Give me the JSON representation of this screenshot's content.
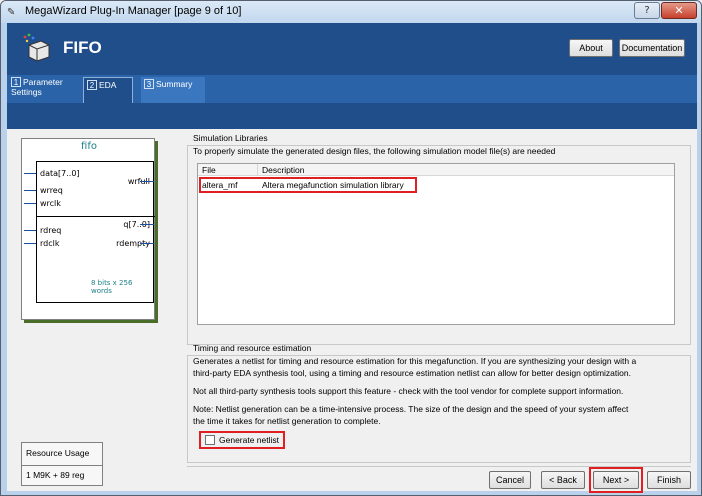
{
  "window": {
    "title": "MegaWizard Plug-In Manager [page 9 of 10]",
    "help_glyph": "?",
    "close_glyph": "✕"
  },
  "header": {
    "title": "FIFO",
    "about_label": "About",
    "documentation_label": "Documentation"
  },
  "tabs": [
    {
      "num": "1",
      "label": "Parameter Settings"
    },
    {
      "num": "2",
      "label": "EDA"
    },
    {
      "num": "3",
      "label": "Summary"
    }
  ],
  "symbol": {
    "name": "fifo",
    "inputs": [
      "data[7..0]",
      "wrreq",
      "wrclk",
      "rdreq",
      "rdclk"
    ],
    "outputs": [
      "wrfull",
      "q[7..0]",
      "rdempty"
    ],
    "footer": "8 bits x 256 words"
  },
  "resource": {
    "label": "Resource Usage",
    "value": "1 M9K + 89 reg"
  },
  "simulation": {
    "title": "Simulation Libraries",
    "description": "To properly simulate the generated design files, the following simulation model file(s) are needed",
    "columns": [
      "File",
      "Description"
    ],
    "rows": [
      {
        "file": "altera_mf",
        "description": "Altera megafunction simulation library"
      }
    ]
  },
  "timing": {
    "title": "Timing and resource estimation",
    "para1_line1": "Generates a netlist for timing and resource estimation for this megafunction. If you are synthesizing your design with a",
    "para1_line2": "third-party EDA synthesis tool, using a timing and resource estimation netlist can allow for better design optimization.",
    "para2": "Not all third-party synthesis tools support this feature - check with the tool vendor for complete support information.",
    "para3_line1": "Note: Netlist generation can be a time-intensive process. The size of the design and the speed of your system affect",
    "para3_line2": "the time it takes for netlist generation to complete.",
    "checkbox_label": "Generate netlist",
    "checked": false
  },
  "footer": {
    "cancel_label": "Cancel",
    "back_label": "< Back",
    "next_label": "Next >",
    "finish_label": "Finish"
  },
  "colors": {
    "header": "#1f4e8a",
    "highlight": "#e02020",
    "symbol_accent": "#1e7f8a"
  }
}
